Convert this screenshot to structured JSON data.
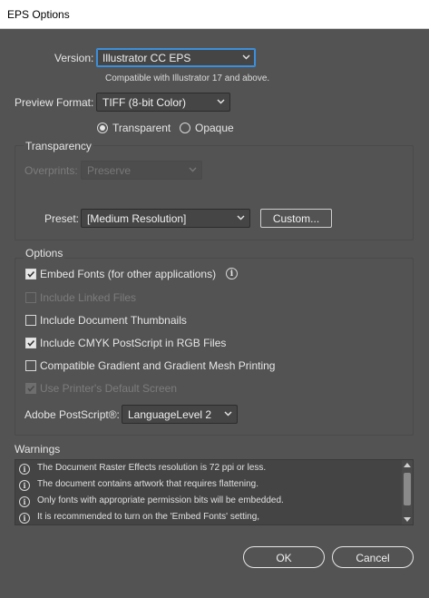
{
  "window": {
    "title": "EPS Options"
  },
  "version": {
    "label": "Version:",
    "value": "Illustrator CC EPS",
    "note": "Compatible with Illustrator 17 and above."
  },
  "preview": {
    "label": "Preview Format:",
    "value": "TIFF (8-bit Color)",
    "transparent_label": "Transparent",
    "opaque_label": "Opaque",
    "selected": "Transparent"
  },
  "transparency": {
    "title": "Transparency",
    "overprints_label": "Overprints:",
    "overprints_value": "Preserve",
    "preset_label": "Preset:",
    "preset_value": "[Medium Resolution]",
    "custom_button": "Custom..."
  },
  "options": {
    "title": "Options",
    "embed_fonts": {
      "label": "Embed Fonts (for other applications)",
      "checked": true,
      "enabled": true
    },
    "include_linked": {
      "label": "Include Linked Files",
      "checked": false,
      "enabled": false
    },
    "include_thumbnails": {
      "label": "Include Document Thumbnails",
      "checked": false,
      "enabled": true
    },
    "include_cmyk": {
      "label": "Include CMYK PostScript in RGB Files",
      "checked": true,
      "enabled": true
    },
    "compatible_gradient": {
      "label": "Compatible Gradient and Gradient Mesh Printing",
      "checked": false,
      "enabled": true
    },
    "printer_default": {
      "label": "Use Printer's Default Screen",
      "checked": true,
      "enabled": false
    },
    "postscript_label": "Adobe PostScript®:",
    "postscript_value": "LanguageLevel 2"
  },
  "warnings": {
    "title": "Warnings",
    "items": [
      "The Document Raster Effects resolution is 72 ppi or less.",
      "The document contains artwork that requires flattening.",
      "Only fonts with appropriate permission bits will be embedded.",
      "It is recommended to turn on the 'Embed Fonts' setting,"
    ]
  },
  "buttons": {
    "ok": "OK",
    "cancel": "Cancel"
  },
  "colors": {
    "background": "#535353",
    "focus": "#3b8fdc",
    "titlebar": "#ffffff"
  }
}
